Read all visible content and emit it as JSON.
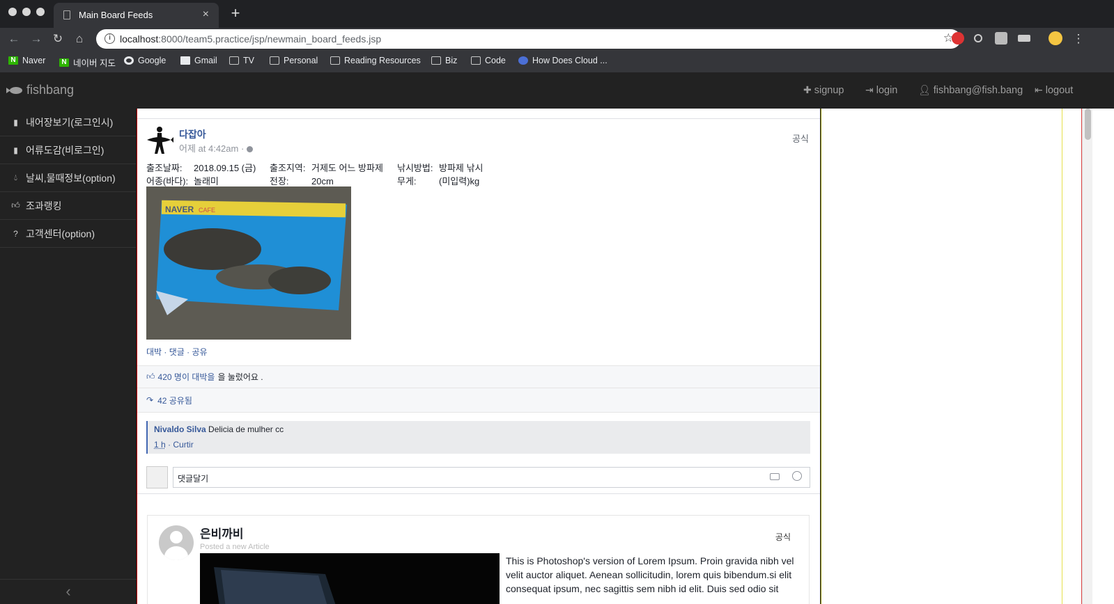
{
  "browser": {
    "tab_title": "Main Board Feeds",
    "tab_close": "×",
    "new_tab": "+",
    "url_host": "localhost",
    "url_rest": ":8000/team5.practice/jsp/newmain_board_feeds.jsp",
    "bookmarks": [
      {
        "label": "Naver",
        "icon": "naver-icon"
      },
      {
        "label": "네이버 지도",
        "icon": "naver-icon"
      },
      {
        "label": "Google",
        "icon": "google-icon"
      },
      {
        "label": "Gmail",
        "icon": "gmail-icon"
      },
      {
        "label": "TV",
        "icon": "folder-icon"
      },
      {
        "label": "Personal",
        "icon": "folder-icon"
      },
      {
        "label": "Reading Resources",
        "icon": "folder-icon"
      },
      {
        "label": "Biz",
        "icon": "folder-icon"
      },
      {
        "label": "Code",
        "icon": "folder-icon"
      },
      {
        "label": "How Does Cloud ...",
        "icon": "cloud-icon"
      }
    ]
  },
  "app": {
    "brand": "fishbang",
    "nav": {
      "signup": "signup",
      "login": "login",
      "user": "fishbang@fish.bang",
      "logout": "logout"
    }
  },
  "sidebar": {
    "items": [
      {
        "label": "내어장보기(로그인시)",
        "icon": "book-icon"
      },
      {
        "label": "어류도감(비로그인)",
        "icon": "book-icon"
      },
      {
        "label": "날씨,물때정보(option)",
        "icon": "drop-icon"
      },
      {
        "label": "조과랭킹",
        "icon": "thumbs-up-icon"
      },
      {
        "label": "고객센터(option)",
        "icon": "help-icon"
      }
    ],
    "collapse": "‹"
  },
  "feed": {
    "author": "다잡아",
    "time": "어제 at 4:42am · ",
    "badge": "공식",
    "info": {
      "date_label": "출조날짜:",
      "date_value": "2018.09.15 (금)",
      "region_label": "출조지역:",
      "region_value": "거제도 어느 방파제",
      "method_label": "낚시방법:",
      "method_value": "방파제 낚시",
      "species_label": "어종(바다):",
      "species_value": "놀래미",
      "length_label": "전장:",
      "length_value": "20cm",
      "weight_label": "무게:",
      "weight_value": "(미입력)kg"
    },
    "photo_watermark": "NAVER",
    "photo_watermark2": "CAFE",
    "actions": "대박 · 댓글 · 공유",
    "likes_link": "420 명이 대박을",
    "likes_rest": "을 눌렀어요 .",
    "shares": "42 공유됨",
    "comment": {
      "author": "Nivaldo Silva",
      "text": "Delicia de mulher cc",
      "time": "1 h",
      "like": " · Curtir"
    },
    "reply_placeholder": "댓글달기"
  },
  "post2": {
    "author": "은비까비",
    "subtitle": "Posted a new Article",
    "badge": "공식",
    "text": "This is Photoshop's version of Lorem Ipsum. Proin gravida nibh vel velit auctor aliquet. Aenean sollicitudin, lorem quis bibendum.si elit consequat ipsum, nec sagittis sem nibh id elit. Duis sed odio sit"
  }
}
